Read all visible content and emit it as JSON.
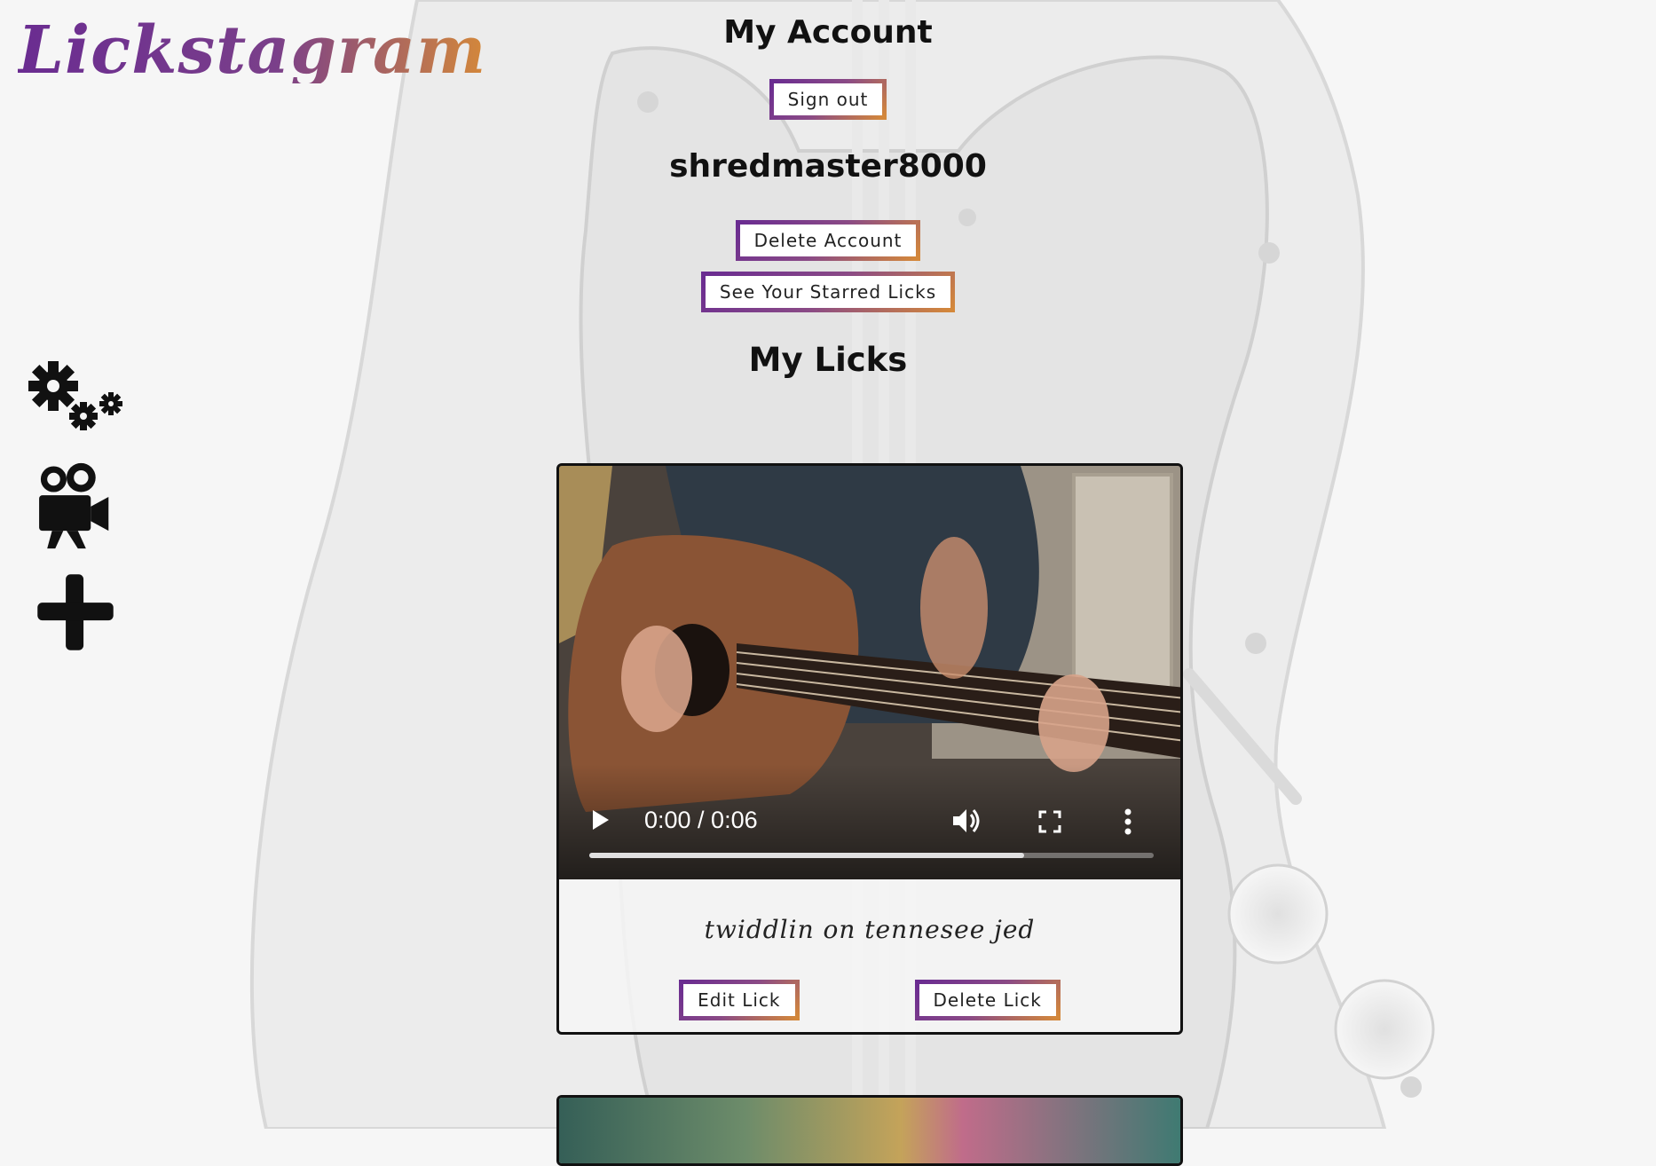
{
  "app": {
    "logo_text": "Lickstagram"
  },
  "sidebar": {
    "items": [
      {
        "name": "settings",
        "icon": "gears-icon"
      },
      {
        "name": "my-licks",
        "icon": "movie-camera-icon"
      },
      {
        "name": "add-lick",
        "icon": "plus-icon"
      }
    ]
  },
  "account": {
    "heading": "My Account",
    "sign_out_label": "Sign out",
    "username": "shredmaster8000",
    "delete_account_label": "Delete Account",
    "starred_label": "See Your Starred Licks"
  },
  "licks": {
    "heading": "My Licks",
    "items": [
      {
        "time_display": "0:00 / 0:06",
        "progress": 0.77,
        "caption": "twiddlin on tennesee jed",
        "edit_label": "Edit Lick",
        "delete_label": "Delete Lick"
      }
    ]
  },
  "colors": {
    "gradient_start": "#6a2c91",
    "gradient_end": "#d4883a",
    "text": "#111111"
  }
}
